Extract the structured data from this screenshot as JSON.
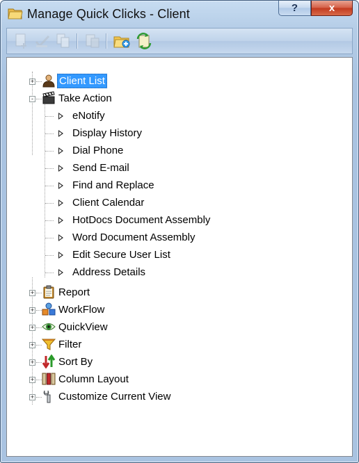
{
  "window": {
    "title": "Manage Quick Clicks - Client"
  },
  "titlebar_buttons": {
    "help": "?",
    "close": "x"
  },
  "toolbar": {
    "buttons": [
      {
        "icon": "add-item-icon",
        "enabled": false
      },
      {
        "icon": "edit-check-icon",
        "enabled": false
      },
      {
        "icon": "copy-icon",
        "enabled": false
      },
      {
        "icon": "delete-icon",
        "enabled": false
      },
      {
        "icon": "new-folder-icon",
        "enabled": true
      },
      {
        "icon": "refresh-icon",
        "enabled": true
      }
    ]
  },
  "tree": {
    "nodes": [
      {
        "label": "Client List",
        "icon": "client-person-icon",
        "expander": "+",
        "selected": true
      },
      {
        "label": "Take Action",
        "icon": "clapboard-icon",
        "expander": "-",
        "children": [
          "eNotify",
          "Display History",
          "Dial Phone",
          "Send E-mail",
          "Find and Replace",
          "Client Calendar",
          "HotDocs Document Assembly",
          "Word Document Assembly",
          "Edit Secure User List",
          "Address Details"
        ]
      },
      {
        "label": "Report",
        "icon": "clipboard-icon",
        "expander": "+"
      },
      {
        "label": "WorkFlow",
        "icon": "workflow-icon",
        "expander": "+"
      },
      {
        "label": "QuickView",
        "icon": "eye-icon",
        "expander": "+"
      },
      {
        "label": "Filter",
        "icon": "funnel-icon",
        "expander": "+"
      },
      {
        "label": "Sort By",
        "icon": "sort-arrows-icon",
        "expander": "+"
      },
      {
        "label": "Column Layout",
        "icon": "columns-icon",
        "expander": "+"
      },
      {
        "label": "Customize Current View",
        "icon": "wrench-icon",
        "expander": "+"
      }
    ]
  }
}
